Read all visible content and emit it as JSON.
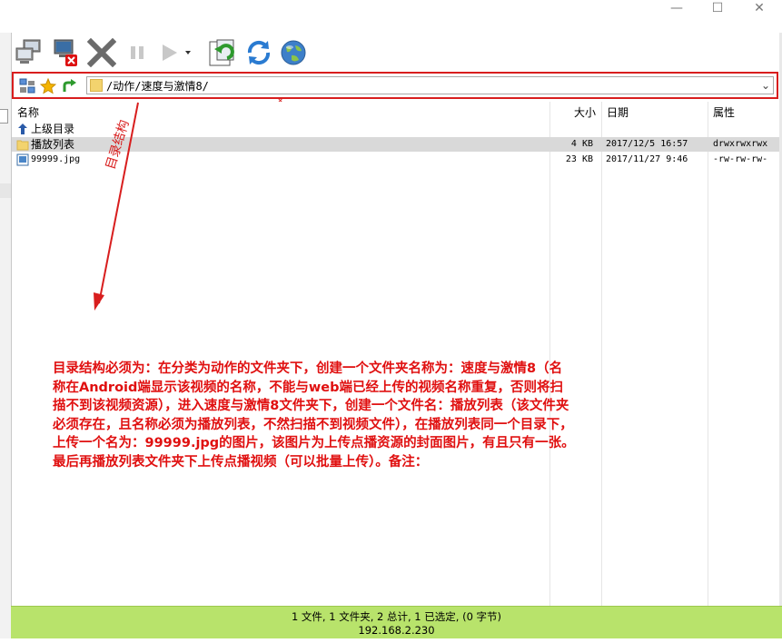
{
  "window": {
    "minimize_glyph": "—",
    "maximize_glyph": "☐",
    "close_glyph": "✕"
  },
  "toolbar": {
    "buttons": [
      {
        "icon": "connect-computers-icon"
      },
      {
        "icon": "disconnect-computer-icon"
      },
      {
        "icon": "cancel-x-icon"
      },
      {
        "icon": "pause-icon"
      },
      {
        "icon": "play-icon"
      },
      {
        "icon": "refresh-download-icon"
      },
      {
        "icon": "sync-arrows-icon"
      },
      {
        "icon": "globe-icon"
      }
    ]
  },
  "pathbar": {
    "path": "/动作/速度与激情8/",
    "icons": [
      "tree-view-icon",
      "bookmark-star-icon",
      "parent-dir-icon"
    ]
  },
  "file_list": {
    "columns": {
      "name": "名称",
      "size": "大小",
      "date": "日期",
      "attr": "属性"
    },
    "rows": [
      {
        "name": "上级目录",
        "size": "",
        "date": "",
        "attr": "",
        "icon": "up-arrow-icon",
        "selected": false
      },
      {
        "name": "播放列表",
        "size": "4 KB",
        "date": "2017/12/5 16:57",
        "attr": "drwxrwxrwx",
        "icon": "folder-icon",
        "selected": true
      },
      {
        "name": "99999.jpg",
        "size": "23 KB",
        "date": "2017/11/27 9:46",
        "attr": "-rw-rw-rw-",
        "icon": "image-file-icon",
        "selected": false
      }
    ]
  },
  "annotations": {
    "arrow_label": "目录结构",
    "instruction": "目录结构必须为：在分类为动作的文件夹下，创建一个文件夹名称为：速度与激情8（名称在Android端显示该视频的名称，不能与web端已经上传的视频名称重复，否则将扫描不到该视频资源），进入速度与激情8文件夹下，创建一个文件名：播放列表（该文件夹必须存在，且名称必须为播放列表，不然扫描不到视频文件），在播放列表同一个目录下，上传一个名为：99999.jpg的图片，该图片为上传点播资源的封面图片，有且只有一张。最后再播放列表文件夹下上传点播视频（可以批量上传）。备注：",
    "color": "#e01010"
  },
  "statusbar": {
    "summary": "1 文件, 1 文件夹, 2 总计, 1 已选定, (0 字节)",
    "host": "192.168.2.230",
    "color": "#b8e36b"
  }
}
